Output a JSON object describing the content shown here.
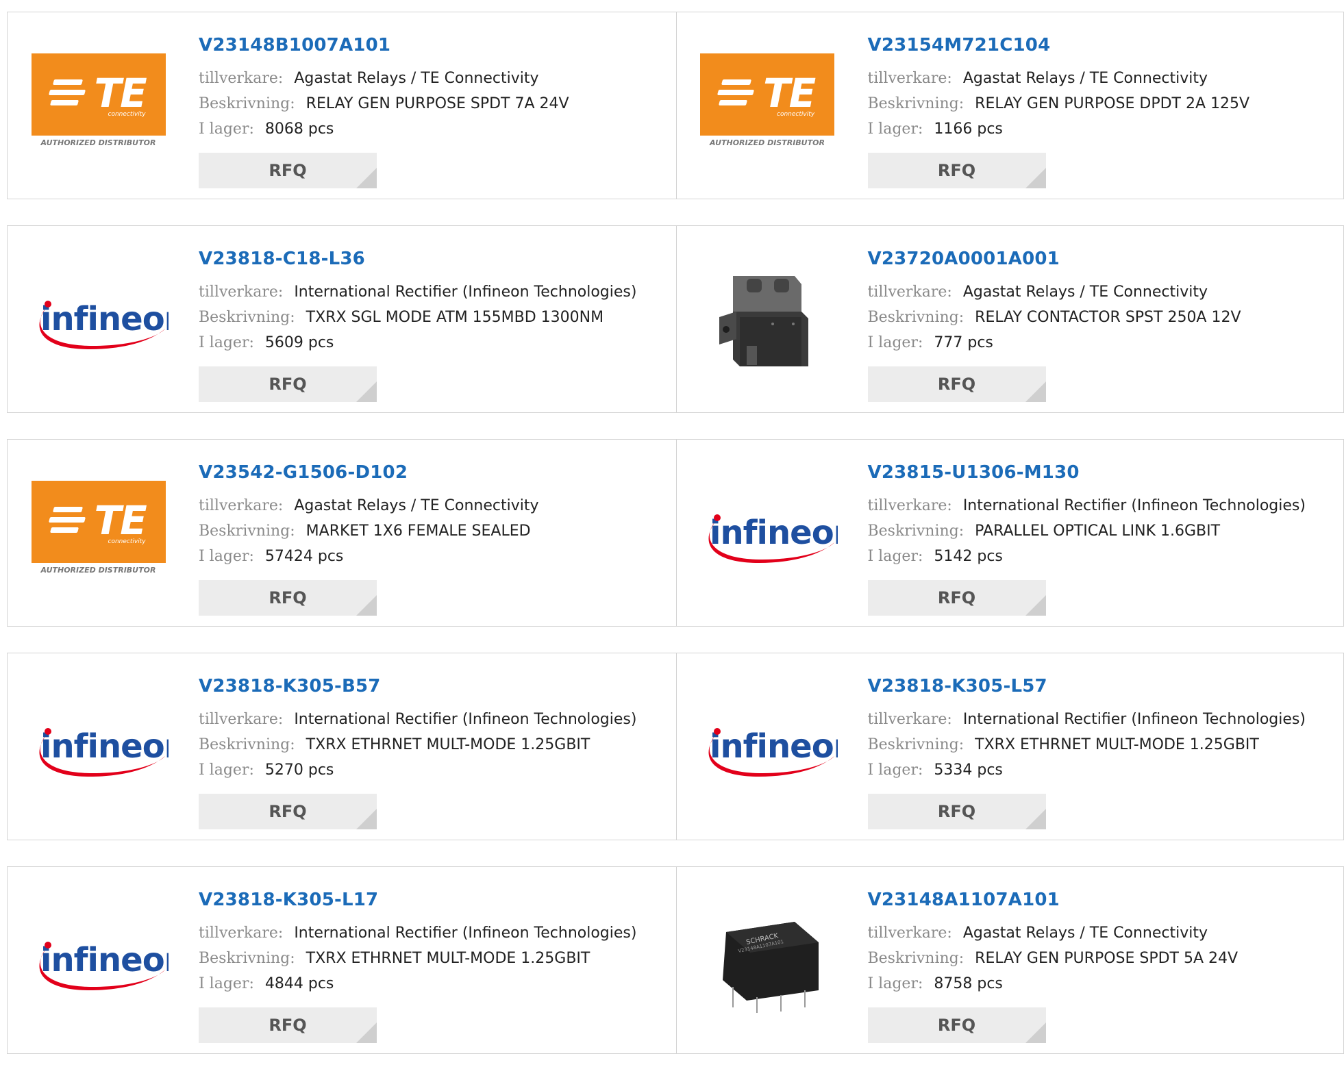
{
  "labels": {
    "manufacturer": "tillverkare:",
    "description": "Beskrivning:",
    "stock": "I lager:",
    "rfq": "RFQ"
  },
  "logos": {
    "te": {
      "text": "TE",
      "sub": "connectivity",
      "authorized": "AUTHORIZED DISTRIBUTOR",
      "color": "#f28c1c"
    },
    "infineon": {
      "text": "infineon",
      "color": "#1e4fa0",
      "swoosh": "#e2001a"
    }
  },
  "products": [
    {
      "part": "V23148B1007A101",
      "manufacturer": "Agastat Relays / TE Connectivity",
      "description": "RELAY GEN PURPOSE SPDT 7A 24V",
      "stock": "8068 pcs",
      "image": "te-logo"
    },
    {
      "part": "V23154M721C104",
      "manufacturer": "Agastat Relays / TE Connectivity",
      "description": "RELAY GEN PURPOSE DPDT 2A 125V",
      "stock": "1166 pcs",
      "image": "te-logo"
    },
    {
      "part": "V23818-C18-L36",
      "manufacturer": "International Rectifier (Infineon Technologies)",
      "description": "TXRX SGL MODE ATM 155MBD 1300NM",
      "stock": "5609 pcs",
      "image": "infineon-logo"
    },
    {
      "part": "V23720A0001A001",
      "manufacturer": "Agastat Relays / TE Connectivity",
      "description": "RELAY CONTACTOR SPST 250A 12V",
      "stock": "777 pcs",
      "image": "contactor-photo"
    },
    {
      "part": "V23542-G1506-D102",
      "manufacturer": "Agastat Relays / TE Connectivity",
      "description": "MARKET 1X6 FEMALE SEALED",
      "stock": "57424 pcs",
      "image": "te-logo"
    },
    {
      "part": "V23815-U1306-M130",
      "manufacturer": "International Rectifier (Infineon Technologies)",
      "description": "PARALLEL OPTICAL LINK 1.6GBIT",
      "stock": "5142 pcs",
      "image": "infineon-logo"
    },
    {
      "part": "V23818-K305-B57",
      "manufacturer": "International Rectifier (Infineon Technologies)",
      "description": "TXRX ETHRNET MULT-MODE 1.25GBIT",
      "stock": "5270 pcs",
      "image": "infineon-logo"
    },
    {
      "part": "V23818-K305-L57",
      "manufacturer": "International Rectifier (Infineon Technologies)",
      "description": "TXRX ETHRNET MULT-MODE 1.25GBIT",
      "stock": "5334 pcs",
      "image": "infineon-logo"
    },
    {
      "part": "V23818-K305-L17",
      "manufacturer": "International Rectifier (Infineon Technologies)",
      "description": "TXRX ETHRNET MULT-MODE 1.25GBIT",
      "stock": "4844 pcs",
      "image": "infineon-logo"
    },
    {
      "part": "V23148A1107A101",
      "manufacturer": "Agastat Relays / TE Connectivity",
      "description": "RELAY GEN PURPOSE SPDT 5A 24V",
      "stock": "8758 pcs",
      "image": "relay-photo"
    }
  ]
}
